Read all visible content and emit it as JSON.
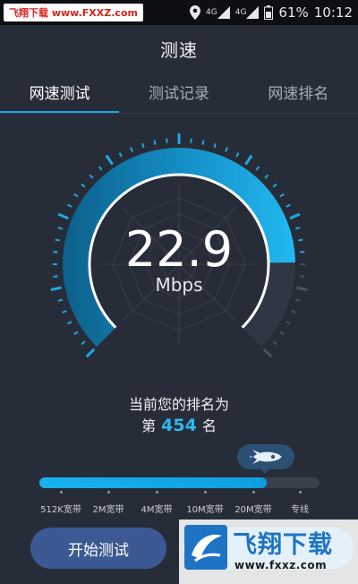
{
  "status_bar": {
    "watermark": "飞翔下载 www.FXXZ.com",
    "network_1": "4G",
    "network_2": "4G",
    "battery": "61%",
    "time": "10:12"
  },
  "header": {
    "title": "测速"
  },
  "tabs": [
    {
      "label": "网速测试",
      "active": true
    },
    {
      "label": "测试记录",
      "active": false
    },
    {
      "label": "网速排名",
      "active": false
    }
  ],
  "gauge": {
    "value": "22.9",
    "unit": "Mbps",
    "fill_fraction": 0.83
  },
  "rank": {
    "prefix_text": "当前您的排名为",
    "pre": "第",
    "number": "454",
    "post": "名"
  },
  "bandwidth": {
    "fill_fraction": 0.81,
    "labels": [
      "512K宽带",
      "2M宽带",
      "4M宽带",
      "10M宽带",
      "20M宽带",
      "专线"
    ]
  },
  "buttons": {
    "start": "开始测试"
  },
  "watermark_bottom": {
    "text": "飞翔下载",
    "url": "www.fxxz.com"
  },
  "colors": {
    "accent": "#1da8e6",
    "background": "#272d38",
    "button": "#3b5a93"
  }
}
